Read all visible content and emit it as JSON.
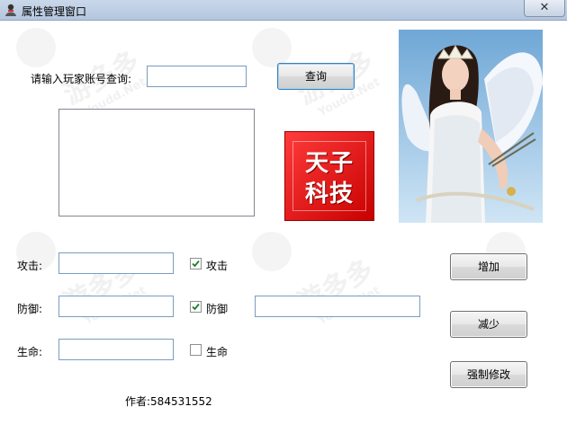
{
  "window": {
    "title": "属性管理窗口",
    "close_symbol": "✕"
  },
  "search": {
    "label": "请输入玩家账号查询:",
    "input_value": "",
    "button_label": "查询"
  },
  "logo": {
    "line1": "天子",
    "line2": "科技"
  },
  "attributes": [
    {
      "label": "攻击:",
      "value": "",
      "checkbox_label": "攻击",
      "checked": true
    },
    {
      "label": "防御:",
      "value": "",
      "checkbox_label": "防御",
      "checked": true
    },
    {
      "label": "生命:",
      "value": "",
      "checkbox_label": "生命",
      "checked": false
    }
  ],
  "extra_input_value": "",
  "actions": {
    "increase_label": "增加",
    "decrease_label": "减少",
    "force_modify_label": "强制修改"
  },
  "author": "作者:584531552",
  "watermark": {
    "brand": "游多多",
    "url": "Youdd.Net"
  },
  "colors": {
    "titlebar": "#c9d7ea",
    "input_border": "#7a9cc0",
    "logo_red": "#e01010",
    "check_green": "#1b7f2a"
  }
}
